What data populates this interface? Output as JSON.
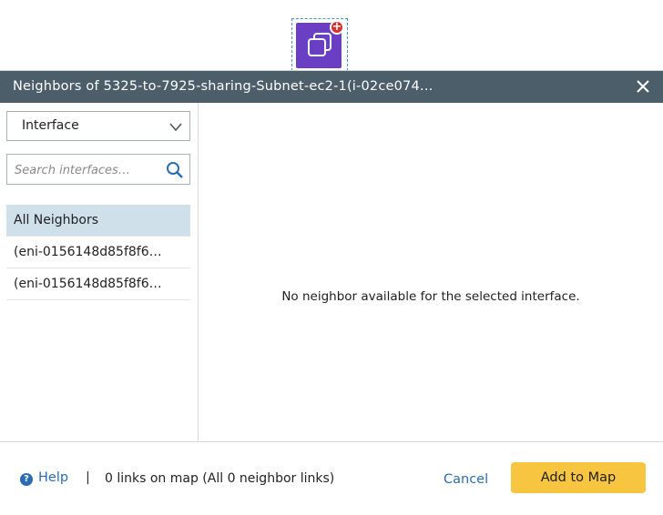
{
  "canvas": {
    "node_icon": "multi-window-node-icon",
    "badge_icon": "add-badge-icon"
  },
  "dialog": {
    "title": "Neighbors of 5325-to-7925-sharing-Subnet-ec2-1(i-02ce074…",
    "close_icon": "close-icon",
    "filter": {
      "selected": "Interface",
      "chevron_icon": "chevron-down-icon"
    },
    "search": {
      "placeholder": "Search interfaces…",
      "value": "",
      "icon": "search-icon"
    },
    "list": [
      {
        "label": "All Neighbors",
        "selected": true
      },
      {
        "label": "(eni-0156148d85f8f6…",
        "selected": false
      },
      {
        "label": "(eni-0156148d85f8f6…",
        "selected": false
      }
    ],
    "empty_message": "No neighbor available for the selected interface."
  },
  "footer": {
    "help_label": "Help",
    "separator": "|",
    "links_status": "0 links on map (All 0 neighbor links)",
    "cancel_label": "Cancel",
    "add_label": "Add to Map"
  },
  "colors": {
    "titlebar": "#4d5e6b",
    "node": "#6b3fc4",
    "selected_row": "#cfe0eb",
    "link": "#2a6db5",
    "primary_button": "#f7c53f"
  }
}
